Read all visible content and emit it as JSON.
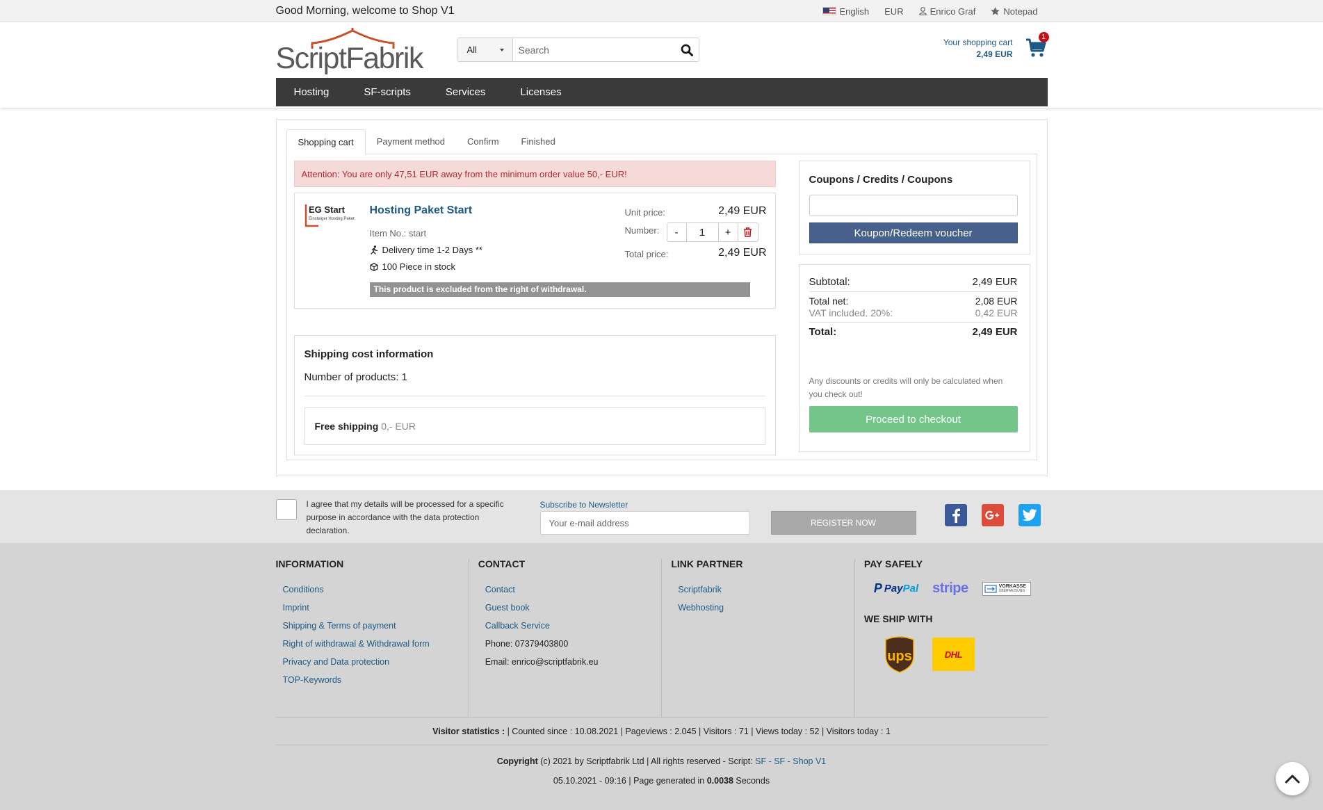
{
  "topbar": {
    "welcome": "Good Morning, welcome to Shop V1",
    "language": "English",
    "currency": "EUR",
    "user": "Enrico Graf",
    "notepad": "Notepad"
  },
  "header": {
    "logo_text": "ScriptFabrik",
    "search_category": "All",
    "search_placeholder": "Search",
    "cart_label": "Your shopping cart",
    "cart_total": "2,49 EUR",
    "cart_count": "1"
  },
  "nav": {
    "items": [
      "Hosting",
      "SF-scripts",
      "Services",
      "Licenses"
    ]
  },
  "tabs": [
    "Shopping cart",
    "Payment method",
    "Confirm",
    "Finished"
  ],
  "alert": "Attention: You are only 47,51 EUR away from the minimum order value 50,- EUR!",
  "item": {
    "img_title": "EG Start",
    "img_subtitle": "Einsteiger Hosting Paket",
    "title": "Hosting Paket Start",
    "item_no": "Item No.: start",
    "delivery": "Delivery time 1-2 Days **",
    "stock": "100 Piece in stock",
    "excluded": "This product is excluded from the right of withdrawal.",
    "unit_label": "Unit price:",
    "unit_price": "2,49 EUR",
    "number_label": "Number:",
    "qty_minus": "-",
    "qty": "1",
    "qty_plus": "+",
    "total_label": "Total price:",
    "total_price": "2,49 EUR"
  },
  "shipping": {
    "title": "Shipping cost information",
    "products": "Number of products: 1",
    "method": "Free shipping",
    "cost": "0,- EUR"
  },
  "coupon": {
    "title": "Coupons / Credits / Coupons",
    "input_value": "",
    "button": "Koupon/Redeem voucher"
  },
  "summary": {
    "subtotal_label": "Subtotal:",
    "subtotal": "2,49 EUR",
    "net_label": "Total net:",
    "net": "2,08 EUR",
    "vat_label": "VAT included. 20%:",
    "vat": "0,42 EUR",
    "total_label": "Total:",
    "total": "2,49 EUR",
    "note": "Any discounts or credits will only be calculated when you check out!",
    "checkout": "Proceed to checkout"
  },
  "newsletter": {
    "agree": "I agree that my details will be processed for a specific purpose in accordance with the data protection declaration.",
    "label": "Subscribe to Newsletter",
    "placeholder": "Your e-mail address",
    "button": "REGISTER NOW"
  },
  "footer": {
    "information": {
      "title": "INFORMATION",
      "links": [
        "Conditions",
        "Imprint",
        "Shipping & Terms of payment",
        "Right of withdrawal & Withdrawal form",
        "Privacy and Data protection",
        "TOP-Keywords"
      ]
    },
    "contact": {
      "title": "CONTACT",
      "links": [
        "Contact",
        "Guest book",
        "Callback Service"
      ],
      "phone": "Phone: 07379403800",
      "email": "Email: enrico@scriptfabrik.eu"
    },
    "partner": {
      "title": "LINK PARTNER",
      "links": [
        "Scriptfabrik",
        "Webhosting"
      ]
    },
    "pay": {
      "title": "PAY SAFELY",
      "paypal_a": "Pay",
      "paypal_b": "Pal",
      "stripe": "stripe",
      "vorkasse": "VORKASSE",
      "vorkasse_sub": "ÜBERWEISUNG",
      "ship_title": "WE SHIP WITH",
      "ups": "ups",
      "dhl": "DHL"
    },
    "stats_label": "Visitor statistics :",
    "stats": " | Counted since : 10.08.2021 | Pageviews : 2.045 | Visitors : 71 | Views today : 52 | Visitors today : 1",
    "copy_label": "Copyright",
    "copy_text": " (c) 2021 by Scriptfabrik Ltd | All rights reserved - Script: ",
    "copy_link": "SF - SF - Shop V1",
    "gen_text": "05.10.2021 - 09:16 | Page generated in ",
    "gen_time": "0.0038",
    "gen_unit": " Seconds"
  },
  "colors": {
    "link": "#1c5a85",
    "nav_bg": "#3a3a3a",
    "coupon_btn": "#47618c",
    "checkout_btn": "#74c58a",
    "badge": "#c0101a"
  }
}
